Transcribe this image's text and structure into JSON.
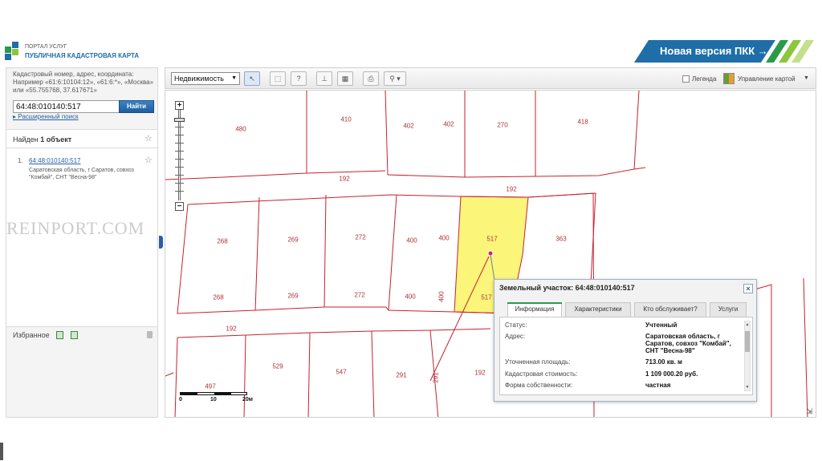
{
  "header": {
    "logo_top": "ПОРТАЛ УСЛУГ",
    "logo_main": "ПУБЛИЧНАЯ КАДАСТРОВАЯ КАРТА",
    "promo": "Новая версия ПКК →"
  },
  "search": {
    "hint": "Кадастровый номер, адрес, координата: Например «61:6:10104:12», «61:6:*», «Москва» или «55.755768, 37.617671»",
    "value": "64:48:010140:517",
    "button": "Найти",
    "advanced": "Расширенный поиск"
  },
  "results": {
    "found_prefix": "Найден",
    "found_count": "1 объект",
    "items": [
      {
        "num": "1.",
        "id": "64:48:010140:517",
        "address": "Саратовская область, г Саратов, совхоз \"Комбай\", СНТ \"Весна-98\""
      }
    ]
  },
  "favorites": {
    "label": "Избранное"
  },
  "watermark": "REINPORT.COM",
  "toolbar": {
    "layer_select": "Недвижимость",
    "legend": "Легенда",
    "map_management": "Управление картой"
  },
  "map": {
    "parcel_labels": [
      "480",
      "410",
      "402",
      "402",
      "270",
      "418",
      "192",
      "192",
      "268",
      "269",
      "272",
      "400",
      "400",
      "517",
      "363",
      "268",
      "269",
      "272",
      "400",
      "400",
      "517",
      "192",
      "497",
      "529",
      "547",
      "291",
      "291",
      "192"
    ],
    "scale": {
      "zero": "0",
      "ten": "10",
      "twenty": "20м"
    }
  },
  "popup": {
    "title": "Земельный участок: 64:48:010140:517",
    "close": "×",
    "tabs": [
      "Информация",
      "Характеристики",
      "Кто обслуживает?",
      "Услуги"
    ],
    "rows": [
      {
        "key": "Статус:",
        "value": "Учтенный"
      },
      {
        "key": "Адрес:",
        "value": "Саратовская область, г Саратов, совхоз \"Комбай\", СНТ \"Весна-98\""
      },
      {
        "key": "Уточненная площадь:",
        "value": "713.00 кв. м"
      },
      {
        "key": "Кадастровая стоимость:",
        "value": "1 109 000.20 руб."
      },
      {
        "key": "Форма собственности:",
        "value": "частная"
      }
    ]
  },
  "colors": {
    "parcel_line": "#c8202e",
    "selected_fill": "#fbf57a",
    "brand_blue": "#1f6ea8",
    "promo_green": "#2a9a4a"
  }
}
